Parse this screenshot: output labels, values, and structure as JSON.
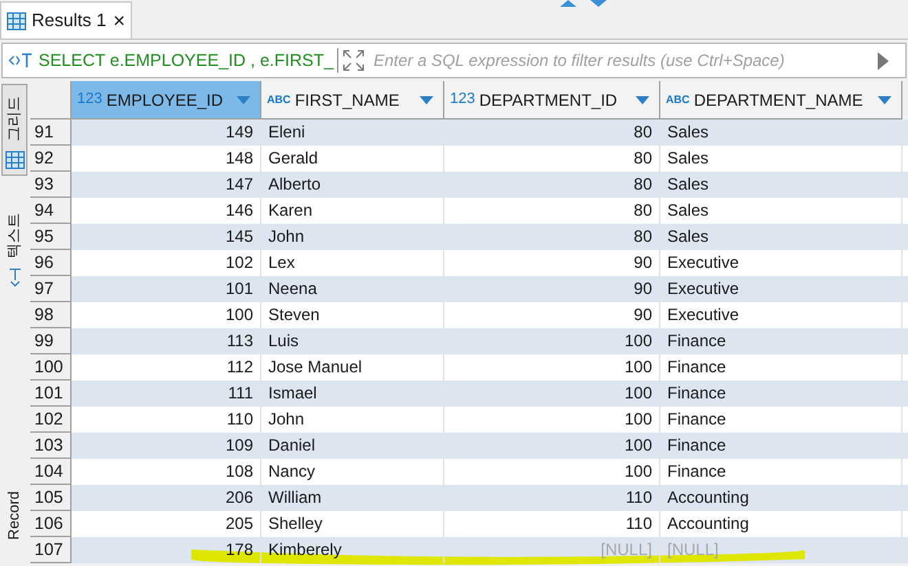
{
  "tab": {
    "label": "Results 1",
    "close": "×"
  },
  "filter": {
    "query": "SELECT e.EMPLOYEE_ID , e.FIRST_",
    "placeholder": "Enter a SQL expression to filter results (use Ctrl+Space)"
  },
  "side_tabs": [
    {
      "label": "그리드",
      "kind": "grid",
      "selected": true
    },
    {
      "label": "텍스트",
      "kind": "text",
      "selected": false
    },
    {
      "label": "Record",
      "kind": "record",
      "selected": false
    }
  ],
  "columns": [
    {
      "type": "123",
      "name": "EMPLOYEE_ID",
      "selected": true
    },
    {
      "type": "ABC",
      "name": "FIRST_NAME",
      "selected": false
    },
    {
      "type": "123",
      "name": "DEPARTMENT_ID",
      "selected": false
    },
    {
      "type": "ABC",
      "name": "DEPARTMENT_NAME",
      "selected": false
    }
  ],
  "rows": [
    {
      "num": "91",
      "cells": [
        "149",
        "Eleni",
        "80",
        "Sales"
      ]
    },
    {
      "num": "92",
      "cells": [
        "148",
        "Gerald",
        "80",
        "Sales"
      ]
    },
    {
      "num": "93",
      "cells": [
        "147",
        "Alberto",
        "80",
        "Sales"
      ]
    },
    {
      "num": "94",
      "cells": [
        "146",
        "Karen",
        "80",
        "Sales"
      ]
    },
    {
      "num": "95",
      "cells": [
        "145",
        "John",
        "80",
        "Sales"
      ]
    },
    {
      "num": "96",
      "cells": [
        "102",
        "Lex",
        "90",
        "Executive"
      ]
    },
    {
      "num": "97",
      "cells": [
        "101",
        "Neena",
        "90",
        "Executive"
      ]
    },
    {
      "num": "98",
      "cells": [
        "100",
        "Steven",
        "90",
        "Executive"
      ]
    },
    {
      "num": "99",
      "cells": [
        "113",
        "Luis",
        "100",
        "Finance"
      ]
    },
    {
      "num": "100",
      "cells": [
        "112",
        "Jose Manuel",
        "100",
        "Finance"
      ]
    },
    {
      "num": "101",
      "cells": [
        "111",
        "Ismael",
        "100",
        "Finance"
      ]
    },
    {
      "num": "102",
      "cells": [
        "110",
        "John",
        "100",
        "Finance"
      ]
    },
    {
      "num": "103",
      "cells": [
        "109",
        "Daniel",
        "100",
        "Finance"
      ]
    },
    {
      "num": "104",
      "cells": [
        "108",
        "Nancy",
        "100",
        "Finance"
      ]
    },
    {
      "num": "105",
      "cells": [
        "206",
        "William",
        "110",
        "Accounting"
      ]
    },
    {
      "num": "106",
      "cells": [
        "205",
        "Shelley",
        "110",
        "Accounting"
      ]
    },
    {
      "num": "107",
      "cells": [
        "178",
        "Kimberely",
        "[NULL]",
        "[NULL]"
      ],
      "null_cells": [
        false,
        false,
        true,
        true
      ],
      "highlighted": true
    }
  ]
}
